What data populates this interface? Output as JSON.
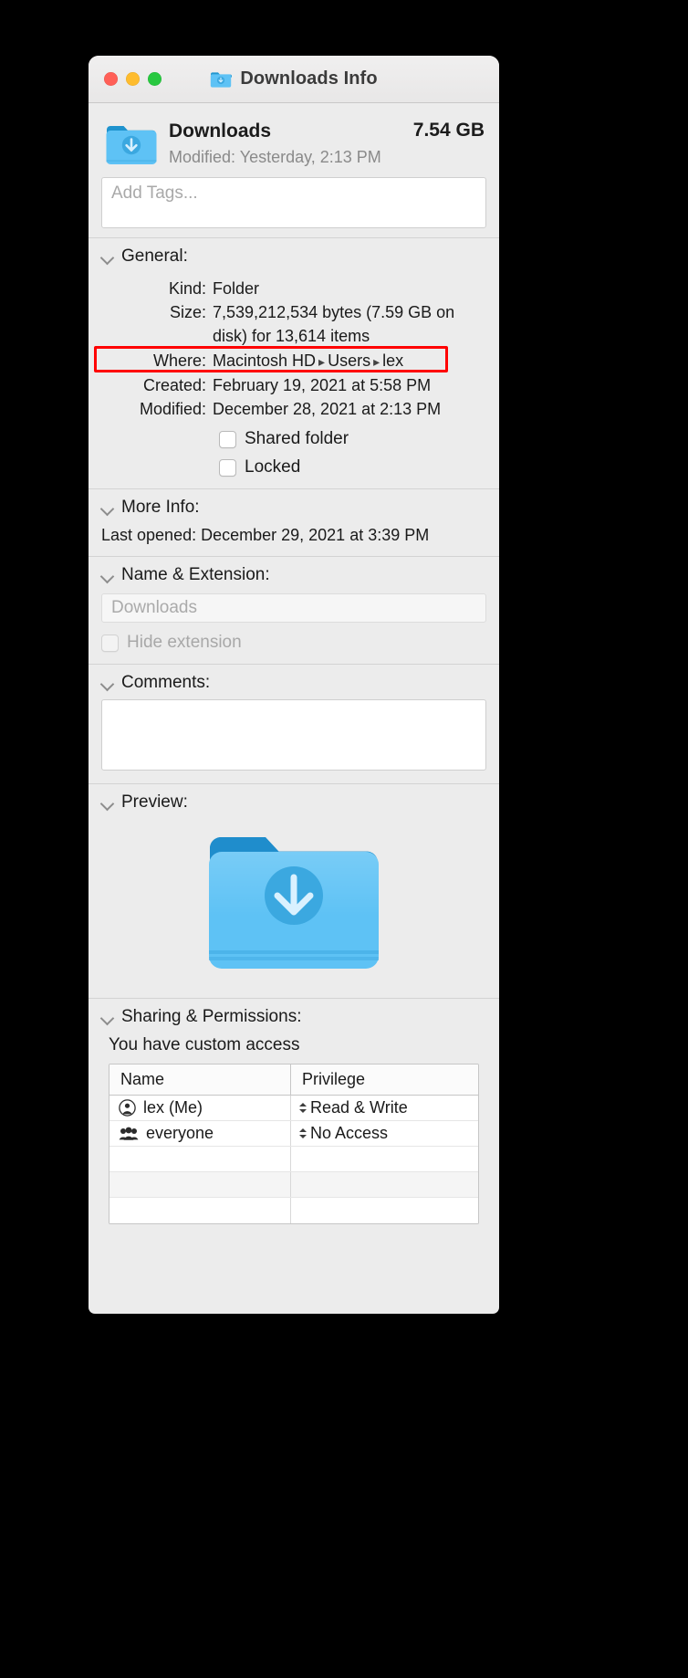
{
  "window": {
    "title": "Downloads Info",
    "title_icon": "folder-downloads-icon",
    "traffic_lights": {
      "close": "close-button",
      "minimize": "minimize-button",
      "zoom": "zoom-button"
    }
  },
  "header": {
    "icon": "folder-downloads-icon",
    "name": "Downloads",
    "modified_label": "Modified:",
    "modified_value": "Yesterday, 2:13 PM",
    "modified_line": "Modified: Yesterday, 2:13 PM",
    "size": "7.54 GB"
  },
  "tags": {
    "placeholder": "Add Tags...",
    "value": ""
  },
  "general": {
    "title": "General:",
    "rows": [
      {
        "label": "Kind:",
        "value": "Folder"
      },
      {
        "label": "Size:",
        "value": "7,539,212,534 bytes (7.59 GB on disk) for 13,614 items"
      },
      {
        "label": "Created:",
        "value": "February 19, 2021 at 5:58 PM"
      },
      {
        "label": "Modified:",
        "value": "December 28, 2021 at 2:13 PM"
      }
    ],
    "where": {
      "label": "Where:",
      "parts": [
        "Macintosh HD",
        "Users",
        "lex"
      ],
      "separator": "▸",
      "highlight_color": "#ff0000"
    },
    "checkboxes": [
      {
        "label": "Shared folder",
        "checked": false,
        "disabled": false
      },
      {
        "label": "Locked",
        "checked": false,
        "disabled": false
      }
    ]
  },
  "more_info": {
    "title": "More Info:",
    "last_opened_label": "Last opened:",
    "last_opened_value": "December 29, 2021 at 3:39 PM",
    "last_opened_line": "Last opened: December 29, 2021 at 3:39 PM"
  },
  "name_extension": {
    "title": "Name & Extension:",
    "value": "Downloads",
    "hide_extension_label": "Hide extension",
    "hide_extension_checked": false,
    "hide_extension_disabled": true
  },
  "comments": {
    "title": "Comments:",
    "value": ""
  },
  "preview": {
    "title": "Preview:",
    "icon": "folder-downloads-icon"
  },
  "sharing": {
    "title": "Sharing & Permissions:",
    "note": "You have custom access",
    "columns": [
      "Name",
      "Privilege"
    ],
    "rows": [
      {
        "icon": "user-icon",
        "name": "lex (Me)",
        "privilege": "Read & Write"
      },
      {
        "icon": "group-icon",
        "name": "everyone",
        "privilege": "No Access"
      },
      {
        "icon": "",
        "name": "",
        "privilege": ""
      },
      {
        "icon": "",
        "name": "",
        "privilege": ""
      },
      {
        "icon": "",
        "name": "",
        "privilege": ""
      }
    ]
  }
}
